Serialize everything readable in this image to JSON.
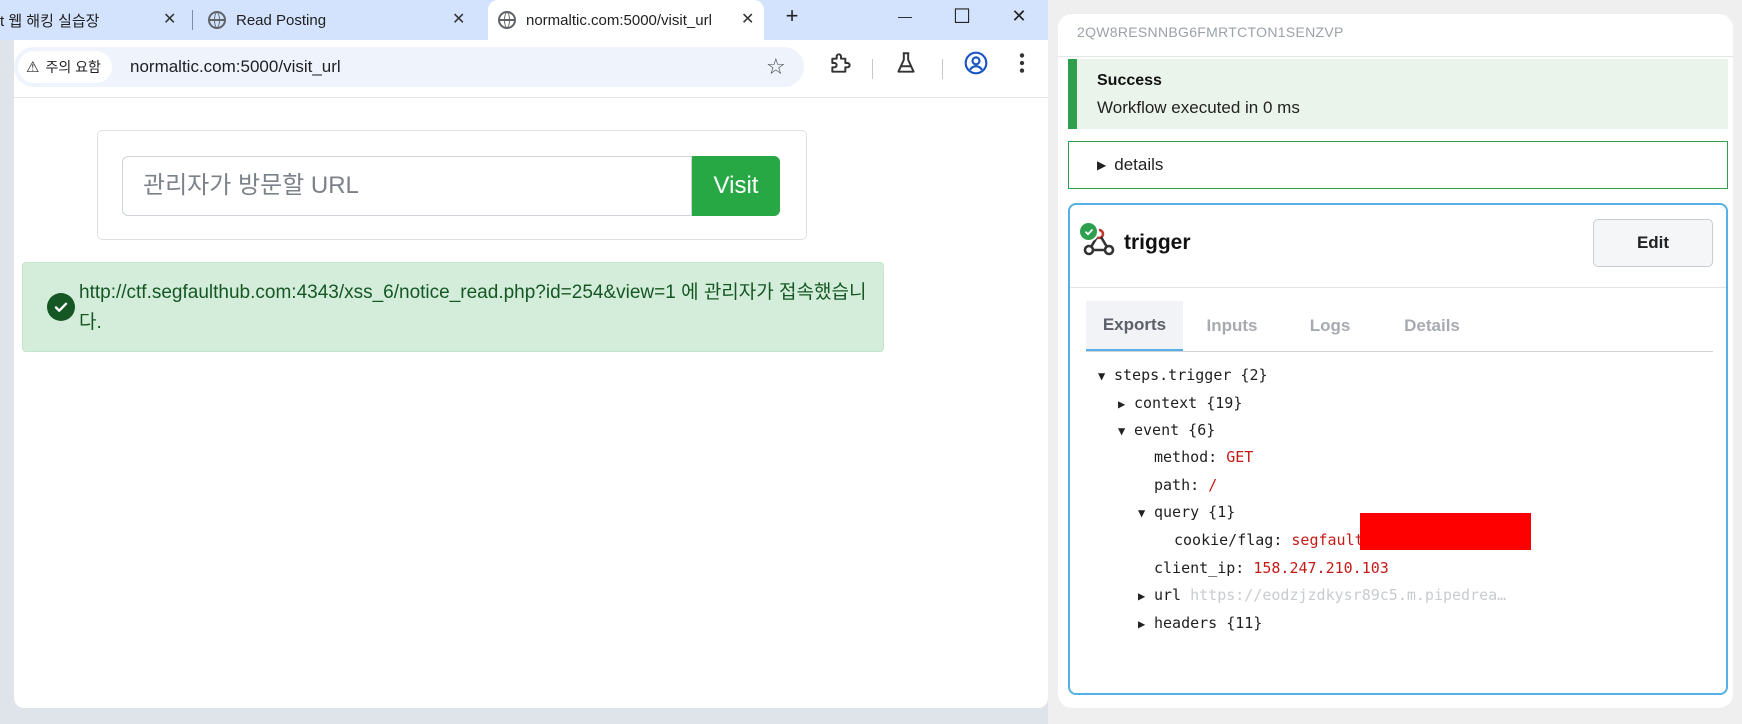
{
  "browser": {
    "tabs": [
      {
        "title": "t 웹 해킹 실습장",
        "active": false
      },
      {
        "title": "Read Posting",
        "active": false
      },
      {
        "title": "normaltic.com:5000/visit_url",
        "active": true
      }
    ],
    "new_tab_label": "+",
    "window_buttons": {
      "minimize": "—",
      "maximize": "☐",
      "close": "✕"
    },
    "security_chip": "주의 요함",
    "address": "normaltic.com:5000/visit_url"
  },
  "page": {
    "input_placeholder": "관리자가 방문할 URL",
    "visit_button": "Visit",
    "alert_text": "http://ctf.segfaulthub.com:4343/xss_6/notice_read.php?id=254&view=1 에 관리자가 접속했습니다."
  },
  "panel": {
    "id": "2QW8RESNNBG6FMRTCTON1SENZVP",
    "success_title": "Success",
    "success_msg": "Workflow executed in 0 ms",
    "details_label": "details",
    "trigger_title": "trigger",
    "edit_button": "Edit",
    "tabs": [
      "Exports",
      "Inputs",
      "Logs",
      "Details"
    ],
    "active_tab": "Exports",
    "tree": {
      "root": "steps.trigger {2}",
      "context": "context {19}",
      "event": "event {6}",
      "method_key": "method:",
      "method_val": "GET",
      "path_key": "path:",
      "path_val": "/",
      "query": "query {1}",
      "cookie_key": "cookie/flag:",
      "cookie_val": "segfault",
      "client_ip_key": "client_ip:",
      "client_ip_val": "158.247.210.103",
      "url_key": "url",
      "url_val": "https://eodzjzdkysr89c5.m.pipedrea…",
      "headers": "headers {11}"
    }
  },
  "colors": {
    "success_green": "#28a745",
    "alert_bg": "#d4edda",
    "panel_accent": "#56b0e6",
    "redaction": "#ff0000"
  }
}
